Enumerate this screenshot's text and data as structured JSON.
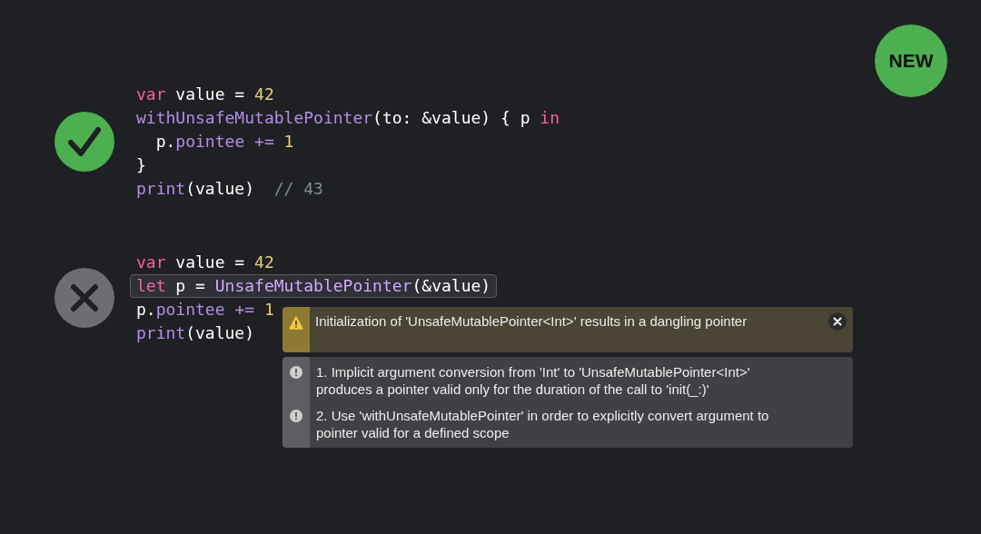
{
  "badge": "NEW",
  "examples": [
    {
      "kind": "pass",
      "lines": [
        {
          "highlighted": false,
          "tokens": [
            {
              "kind": "keyword",
              "text": "var"
            },
            {
              "kind": "plain",
              "text": " value = "
            },
            {
              "kind": "number",
              "text": "42"
            }
          ]
        },
        {
          "highlighted": false,
          "tokens": [
            {
              "kind": "call",
              "text": "withUnsafeMutablePointer"
            },
            {
              "kind": "plain",
              "text": "(to: &value) { p "
            },
            {
              "kind": "keyword",
              "text": "in"
            }
          ]
        },
        {
          "highlighted": false,
          "tokens": [
            {
              "kind": "plain",
              "text": "  p."
            },
            {
              "kind": "call",
              "text": "pointee += "
            },
            {
              "kind": "number",
              "text": "1"
            }
          ]
        },
        {
          "highlighted": false,
          "tokens": [
            {
              "kind": "plain",
              "text": "}"
            }
          ]
        },
        {
          "highlighted": false,
          "tokens": [
            {
              "kind": "call",
              "text": "print"
            },
            {
              "kind": "plain",
              "text": "(value)  "
            },
            {
              "kind": "comment",
              "text": "// 43"
            }
          ]
        }
      ]
    },
    {
      "kind": "fail",
      "lines": [
        {
          "highlighted": false,
          "tokens": [
            {
              "kind": "keyword",
              "text": "var"
            },
            {
              "kind": "plain",
              "text": " value = "
            },
            {
              "kind": "number",
              "text": "42"
            }
          ]
        },
        {
          "highlighted": true,
          "tokens": [
            {
              "kind": "keyword",
              "text": "let"
            },
            {
              "kind": "plain",
              "text": " p = "
            },
            {
              "kind": "type",
              "text": "UnsafeMutablePointer"
            },
            {
              "kind": "plain",
              "text": "(&value)"
            }
          ]
        },
        {
          "highlighted": false,
          "tokens": [
            {
              "kind": "plain",
              "text": "p."
            },
            {
              "kind": "call",
              "text": "pointee += "
            },
            {
              "kind": "number",
              "text": "1"
            }
          ]
        },
        {
          "highlighted": false,
          "tokens": [
            {
              "kind": "call",
              "text": "print"
            },
            {
              "kind": "plain",
              "text": "(value)"
            }
          ]
        }
      ]
    }
  ],
  "diagnostic": {
    "warning": "Initialization of 'UnsafeMutablePointer<Int>' results in a dangling pointer",
    "notes": [
      "1. Implicit argument conversion from 'Int' to 'UnsafeMutablePointer<Int>' produces a pointer valid only for the duration of the call to 'init(_:)'",
      "2. Use 'withUnsafeMutablePointer' in order to explicitly convert argument to pointer valid for a defined scope"
    ]
  }
}
